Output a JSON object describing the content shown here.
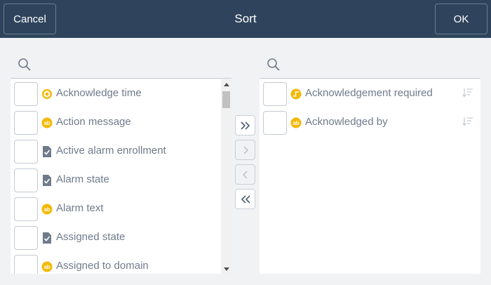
{
  "header": {
    "title": "Sort",
    "cancel_label": "Cancel",
    "ok_label": "OK",
    "background": "#2f445c"
  },
  "available_fields": {
    "search_placeholder": "",
    "items": [
      {
        "label": "Acknowledge time",
        "icon": "time-icon"
      },
      {
        "label": "Action message",
        "icon": "text-icon"
      },
      {
        "label": "Active alarm enrollment",
        "icon": "checked-document-icon"
      },
      {
        "label": "Alarm state",
        "icon": "checked-document-icon"
      },
      {
        "label": "Alarm text",
        "icon": "text-icon"
      },
      {
        "label": "Assigned state",
        "icon": "checked-document-icon"
      },
      {
        "label": "Assigned to domain",
        "icon": "text-icon"
      }
    ]
  },
  "sorted_fields": {
    "search_placeholder": "",
    "items": [
      {
        "label": "Acknowledgement required",
        "icon": "boolean-icon"
      },
      {
        "label": "Acknowledged by",
        "icon": "text-icon"
      }
    ]
  },
  "transfer_buttons": [
    {
      "name": "move-all-right-button",
      "glyph": ">>",
      "enabled": true
    },
    {
      "name": "move-right-button",
      "glyph": ">",
      "enabled": false
    },
    {
      "name": "move-left-button",
      "glyph": "<",
      "enabled": false
    },
    {
      "name": "move-all-left-button",
      "glyph": "<<",
      "enabled": true
    }
  ],
  "colors": {
    "icon_yellow": "#f5b800",
    "icon_gray": "#6f7b8a",
    "text": "#6f7b8a"
  }
}
